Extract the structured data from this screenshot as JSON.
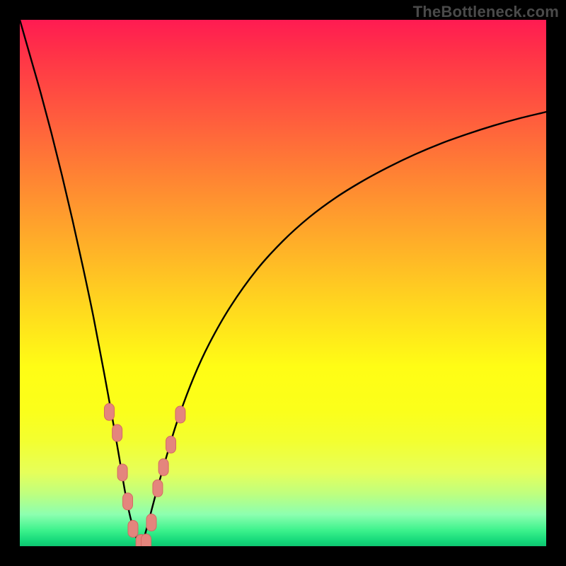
{
  "watermark": "TheBottleneck.com",
  "colors": {
    "curve": "#000000",
    "dot_fill": "#e4857d",
    "dot_stroke": "#d46a62",
    "frame": "#000000"
  },
  "chart_data": {
    "type": "line",
    "title": "",
    "xlabel": "",
    "ylabel": "",
    "xlim": [
      0,
      100
    ],
    "ylim": [
      0,
      100
    ],
    "grid": false,
    "series": [
      {
        "name": "left-branch",
        "x": [
          0,
          2,
          4,
          6,
          8,
          10,
          12,
          14,
          16,
          18,
          19,
          20,
          21,
          22,
          23
        ],
        "y": [
          100,
          93,
          86,
          78.5,
          70.5,
          62,
          53,
          43.5,
          33,
          22,
          16.2,
          10.3,
          5.5,
          2,
          0
        ]
      },
      {
        "name": "right-branch",
        "x": [
          23,
          24,
          26,
          28,
          30,
          33,
          36,
          40,
          45,
          50,
          55,
          60,
          65,
          70,
          75,
          80,
          85,
          90,
          95,
          100
        ],
        "y": [
          0,
          3,
          10.5,
          17.5,
          24,
          32,
          38.5,
          45.5,
          52.5,
          58,
          62.5,
          66.2,
          69.3,
          72,
          74.4,
          76.5,
          78.3,
          79.9,
          81.3,
          82.5
        ]
      }
    ],
    "markers": {
      "name": "highlight-dots",
      "shape": "rounded-rect",
      "points": [
        {
          "x": 17.0,
          "y": 25.5
        },
        {
          "x": 18.5,
          "y": 21.5
        },
        {
          "x": 19.5,
          "y": 14.0
        },
        {
          "x": 20.5,
          "y": 8.5
        },
        {
          "x": 21.5,
          "y": 3.3
        },
        {
          "x": 23.0,
          "y": 0.6
        },
        {
          "x": 24.0,
          "y": 0.7
        },
        {
          "x": 25.0,
          "y": 4.5
        },
        {
          "x": 26.2,
          "y": 11.0
        },
        {
          "x": 27.3,
          "y": 15.0
        },
        {
          "x": 28.7,
          "y": 19.3
        },
        {
          "x": 30.5,
          "y": 25.0
        }
      ]
    }
  }
}
